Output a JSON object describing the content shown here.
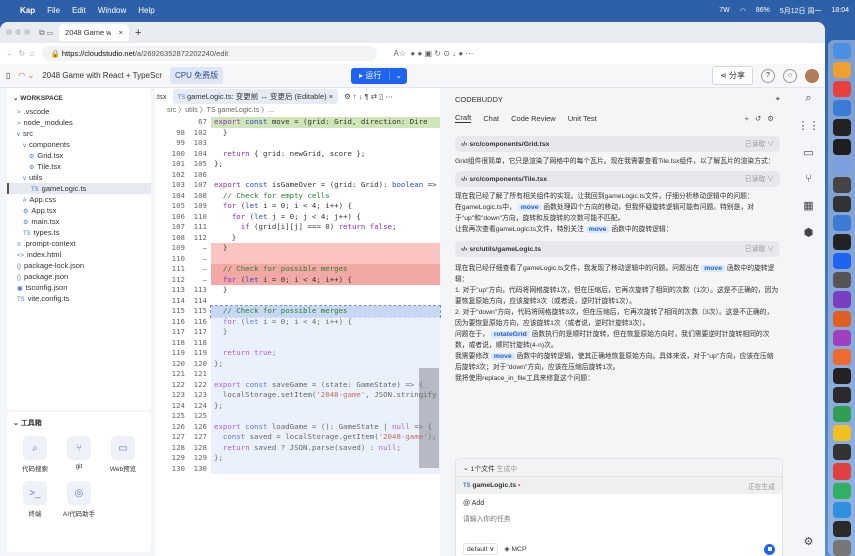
{
  "menubar": {
    "app": "Kap",
    "items": [
      "File",
      "Edit",
      "Window",
      "Help"
    ],
    "status": [
      "7W",
      "86%",
      "5月12日 周一",
      "18:04"
    ]
  },
  "browser": {
    "tab_title": "2048 Game with React + TypeScr",
    "url_host": "https://cloudstudio.net",
    "url_path": "/a/26926352872202240/edit"
  },
  "appbar": {
    "project": "2048 Game with React + TypeScr",
    "cpu": "CPU 免费版",
    "run": "运行",
    "share": "分享"
  },
  "workspace": {
    "title": "WORKSPACE",
    "items": [
      {
        "label": ".vscode",
        "icon": ">",
        "indent": 1
      },
      {
        "label": "node_modules",
        "icon": ">",
        "indent": 1
      },
      {
        "label": "src",
        "icon": "v",
        "indent": 1
      },
      {
        "label": "components",
        "icon": "v",
        "indent": 2
      },
      {
        "label": "Grid.tsx",
        "icon": "⚙",
        "indent": 3
      },
      {
        "label": "Tile.tsx",
        "icon": "⚙",
        "indent": 3
      },
      {
        "label": "utils",
        "icon": "v",
        "indent": 2
      },
      {
        "label": "gameLogic.ts",
        "icon": "TS",
        "indent": 3,
        "selected": true
      },
      {
        "label": "App.css",
        "icon": "#",
        "indent": 2
      },
      {
        "label": "App.tsx",
        "icon": "⚙",
        "indent": 2
      },
      {
        "label": "main.tsx",
        "icon": "⚙",
        "indent": 2
      },
      {
        "label": "types.ts",
        "icon": "TS",
        "indent": 2
      },
      {
        "label": ".prompt-context",
        "icon": "≡",
        "indent": 1
      },
      {
        "label": "index.html",
        "icon": "<>",
        "indent": 1
      },
      {
        "label": "package-lock.json",
        "icon": "{}",
        "indent": 1
      },
      {
        "label": "package.json",
        "icon": "{}",
        "indent": 1
      },
      {
        "label": "tsconfig.json",
        "icon": "▣",
        "indent": 1
      },
      {
        "label": "vite.config.ts",
        "icon": "TS",
        "indent": 1
      }
    ]
  },
  "toolbox": {
    "title": "工具箱",
    "tools": [
      {
        "label": "代码搜索",
        "icon": "⌕"
      },
      {
        "label": "git",
        "icon": "⑂"
      },
      {
        "label": "Web预览",
        "icon": "▭"
      },
      {
        "label": "终端",
        "icon": ">_"
      },
      {
        "label": "AI代码助手",
        "icon": "◎"
      }
    ]
  },
  "editor": {
    "prev_tab": ".tsx",
    "tab": "gameLogic.ts: 变更前 ↔ 变更后 (Editable)",
    "breadcrumb": "src 〉utils 〉TS gameLogic.ts 〉...",
    "rows": [
      {
        "o": "",
        "n": "67",
        "t": "export const move = (grid: Grid, direction: Dire",
        "k": "added"
      },
      {
        "o": "98",
        "n": "102",
        "t": "  }",
        "k": ""
      },
      {
        "o": "99",
        "n": "103",
        "t": "",
        "k": ""
      },
      {
        "o": "100",
        "n": "104",
        "t": "  return { grid: newGrid, score };",
        "k": ""
      },
      {
        "o": "101",
        "n": "105",
        "t": "};",
        "k": ""
      },
      {
        "o": "102",
        "n": "106",
        "t": "",
        "k": ""
      },
      {
        "o": "103",
        "n": "107",
        "t": "export const isGameOver = (grid: Grid): boolean =>",
        "k": ""
      },
      {
        "o": "104",
        "n": "108",
        "t": "  // Check for empty cells",
        "k": ""
      },
      {
        "o": "105",
        "n": "109",
        "t": "  for (let i = 0; i < 4; i++) {",
        "k": ""
      },
      {
        "o": "106",
        "n": "110",
        "t": "    for (let j = 0; j < 4; j++) {",
        "k": ""
      },
      {
        "o": "107",
        "n": "111",
        "t": "      if (grid[i][j] === 0) return false;",
        "k": ""
      },
      {
        "o": "108",
        "n": "112",
        "t": "    }",
        "k": ""
      },
      {
        "o": "109",
        "n": "—",
        "t": "  }",
        "k": "removed"
      },
      {
        "o": "110",
        "n": "—",
        "t": "",
        "k": "removed"
      },
      {
        "o": "111",
        "n": "—",
        "t": "  // Check for possible merges",
        "k": "removed hl"
      },
      {
        "o": "112",
        "n": "—",
        "t": "  for (let i = 0; i < 4; i++) {",
        "k": "removed hl"
      },
      {
        "o": "113",
        "n": "113",
        "t": "  }",
        "k": ""
      },
      {
        "o": "114",
        "n": "114",
        "t": "",
        "k": ""
      },
      {
        "o": "115",
        "n": "115",
        "t": "  // Check for possible merges",
        "k": "sel"
      },
      {
        "o": "116",
        "n": "116",
        "t": "  for (let i = 0; i < 4; i++) {",
        "k": "faded"
      },
      {
        "o": "117",
        "n": "117",
        "t": "  }",
        "k": "faded"
      },
      {
        "o": "118",
        "n": "118",
        "t": "",
        "k": "faded"
      },
      {
        "o": "119",
        "n": "119",
        "t": "  return true;",
        "k": "faded"
      },
      {
        "o": "120",
        "n": "120",
        "t": "};",
        "k": "faded"
      },
      {
        "o": "121",
        "n": "121",
        "t": "",
        "k": "faded"
      },
      {
        "o": "122",
        "n": "122",
        "t": "export const saveGame = (state: GameState) => {",
        "k": "faded"
      },
      {
        "o": "123",
        "n": "123",
        "t": "  localStorage.setItem('2048-game', JSON.stringify",
        "k": "faded"
      },
      {
        "o": "124",
        "n": "124",
        "t": "};",
        "k": "faded"
      },
      {
        "o": "125",
        "n": "125",
        "t": "",
        "k": "faded"
      },
      {
        "o": "126",
        "n": "126",
        "t": "export const loadGame = (): GameState | null => {",
        "k": "faded"
      },
      {
        "o": "127",
        "n": "127",
        "t": "  const saved = localStorage.getItem('2048-game');",
        "k": "faded"
      },
      {
        "o": "128",
        "n": "128",
        "t": "  return saved ? JSON.parse(saved) : null;",
        "k": "faded"
      },
      {
        "o": "129",
        "n": "129",
        "t": "};",
        "k": "faded"
      },
      {
        "o": "130",
        "n": "130",
        "t": "",
        "k": "faded"
      }
    ]
  },
  "codebuddy": {
    "title": "CODEBUDDY",
    "tabs": [
      "Craft",
      "Chat",
      "Code Review",
      "Unit Test"
    ],
    "read_status": "已读取 ∨",
    "files": [
      "src/components/Grid.tsx",
      "src/components/Tile.tsx",
      "src/utils/gameLogic.ts"
    ],
    "msg1": "Grid组件很简单，它只是渲染了网格中的每个瓦片。现在我需要查看Tile.tsx组件，以了解瓦片的渲染方式：",
    "msg2": "现在我已经了解了所有相关组件的实现。让我回到gameLogic.ts文件，仔细分析移动逻辑中的问题：",
    "msg3a": "在gameLogic.ts中，",
    "pill_move": "move",
    "msg3b": "函数处理四个方向的移动，但我怀疑旋转逻辑可能有问题。特别是，对于\"up\"和\"down\"方向，旋转和反旋转的次数可能不匹配。",
    "msg4a": "让我再次查看gameLogic.ts文件，特别关注",
    "msg4b": "函数中的旋转逻辑：",
    "msg5a": "现在我已经仔细查看了gameLogic.ts文件，我发现了移动逻辑中的问题。问题出在",
    "msg5b": "函数中的旋转逻辑：",
    "msg6": "1. 对于\"up\"方向，代码将网格旋转1次，但在压缩后，它再次旋转了相同的次数（1次）。这是不正确的，因为要恢复原始方向，应该旋转3次（或者说，逆时针旋转1次）。",
    "msg7": "2. 对于\"down\"方向，代码将网格旋转3次，但在压缩后，它再次旋转了相同的次数（3次）。这是不正确的，因为要恢复原始方向，应该旋转1次（或者说，逆时针旋转3次）。",
    "msg8a": "问题在于，",
    "pill_rotate": "rotateGrid",
    "msg8b": "函数执行的是顺时针旋转，但在恢复原始方向时，我们需要逆时针旋转相同的次数，或者说，顺时针旋转(4-n)次。",
    "msg9a": "我需要修改",
    "msg9b": "函数中的旋转逻辑，使其正确地恢复原始方向。具体来说，对于\"up\"方向，应该在压缩后旋转3次；对于\"down\"方向，应该在压缩后旋转1次。",
    "msg10": "我将使用replace_in_file工具来修复这个问题：",
    "gen_count": "1个文件",
    "gen_status": "生成中",
    "gen_file": "gameLogic.ts",
    "gen_file_status": "正在生成",
    "add": "@ Add",
    "placeholder": "请输入你的任务",
    "mode": "default ∨",
    "mcp": "◈ MCP"
  }
}
